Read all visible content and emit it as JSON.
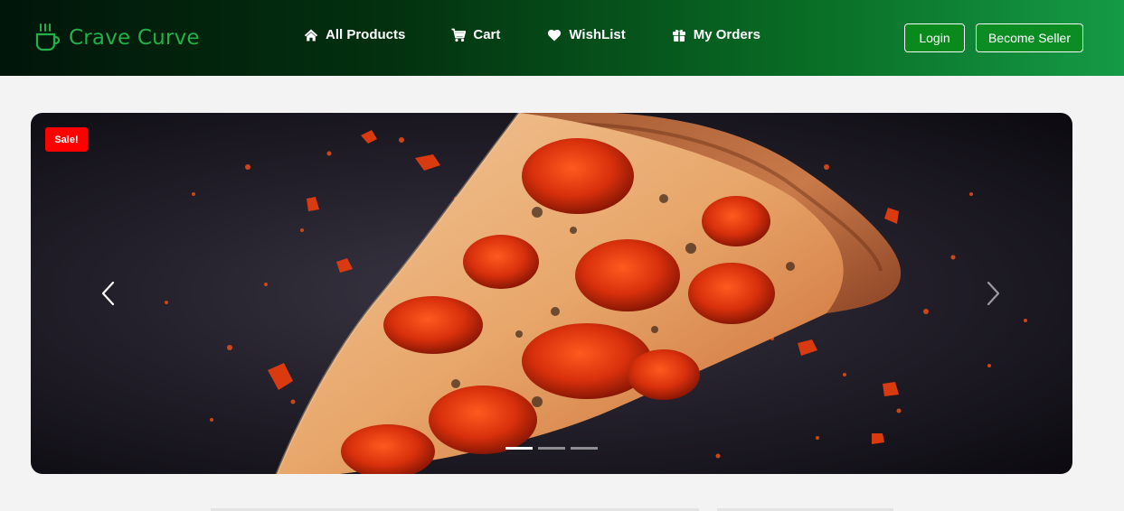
{
  "navbar": {
    "brand": {
      "name": "Crave Curve",
      "icon": "coffee-cup-icon",
      "color": "#22b04b"
    },
    "links": [
      {
        "label": "All Products",
        "icon": "home-icon"
      },
      {
        "label": "Cart",
        "icon": "cart-icon"
      },
      {
        "label": "WishList",
        "icon": "heart-icon"
      },
      {
        "label": "My Orders",
        "icon": "gift-icon"
      }
    ],
    "login_label": "Login",
    "seller_label": "Become Seller"
  },
  "carousel": {
    "badge": "Sale!",
    "badge_color": "#ff0000",
    "slide_image": "pepperoni-pizza-slice",
    "prev_icon": "chevron-left-icon",
    "next_icon": "chevron-right-icon",
    "slide_count": 3,
    "active_slide": 1
  }
}
